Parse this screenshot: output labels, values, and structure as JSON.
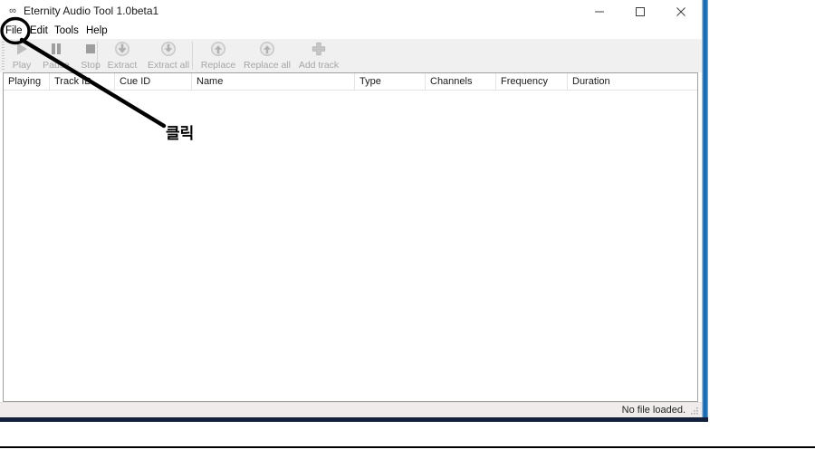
{
  "window": {
    "title": "Eternity Audio Tool 1.0beta1",
    "icon": "infinity-icon",
    "controls": {
      "minimize": "minimize-icon",
      "maximize": "maximize-icon",
      "close": "close-icon"
    },
    "border_color": "#1668b4",
    "bottom_border_color": "#13213c"
  },
  "menu": {
    "items": [
      {
        "label": "File"
      },
      {
        "label": "Edit"
      },
      {
        "label": "Tools"
      },
      {
        "label": "Help"
      }
    ]
  },
  "toolbar": {
    "disabled_label_color": "#a6a6a6",
    "buttons": [
      {
        "label": "Play",
        "icon": "play-icon",
        "enabled": false
      },
      {
        "label": "Pause",
        "icon": "pause-icon",
        "enabled": false
      },
      {
        "label": "Stop",
        "icon": "stop-icon",
        "enabled": false
      },
      {
        "label": "Extract",
        "icon": "arrow-down-circle-icon",
        "enabled": false
      },
      {
        "label": "Extract all",
        "icon": "arrow-down-circle-icon",
        "enabled": false
      },
      {
        "label": "Replace",
        "icon": "arrow-up-circle-icon",
        "enabled": false
      },
      {
        "label": "Replace all",
        "icon": "arrow-up-circle-icon",
        "enabled": false
      },
      {
        "label": "Add track",
        "icon": "plus-icon",
        "enabled": false
      }
    ]
  },
  "list_view": {
    "columns": [
      {
        "label": "Playing"
      },
      {
        "label": "Track ID"
      },
      {
        "label": "Cue ID"
      },
      {
        "label": "Name"
      },
      {
        "label": "Type"
      },
      {
        "label": "Channels"
      },
      {
        "label": "Frequency"
      },
      {
        "label": "Duration"
      }
    ],
    "rows": []
  },
  "status_bar": {
    "text": "No file loaded.",
    "grip": "resize-grip-icon"
  },
  "annotation": {
    "text": "클릭",
    "circle_target": "File",
    "color": "#000000"
  }
}
